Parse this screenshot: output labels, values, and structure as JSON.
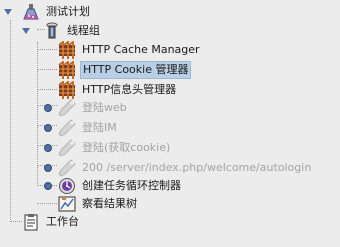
{
  "tree": {
    "test_plan": "测试计划",
    "thread_group": "线程组",
    "items": [
      {
        "label": "HTTP Cache Manager",
        "icon": "config-element-icon"
      },
      {
        "label": "HTTP Cookie 管理器",
        "icon": "config-element-icon",
        "selected": true
      },
      {
        "label": "HTTP信息头管理器",
        "icon": "config-element-icon"
      },
      {
        "label": "登陆web",
        "icon": "sampler-dropper-icon",
        "disabled": true
      },
      {
        "label": "登陆IM",
        "icon": "sampler-dropper-icon",
        "disabled": true
      },
      {
        "label": "登陆(获取cookie)",
        "icon": "sampler-dropper-icon",
        "disabled": true
      },
      {
        "label": "200 /server/index.php/welcome/autologin",
        "icon": "sampler-dropper-icon",
        "disabled": true
      },
      {
        "label": "创建任务循环控制器",
        "icon": "loop-controller-icon"
      },
      {
        "label": "察看结果树",
        "icon": "listener-icon"
      }
    ],
    "workbench": "工作台"
  },
  "colors": {
    "background": "#ececec",
    "selection": "#b8cfe5",
    "disabled_text": "#a3a3a3"
  }
}
